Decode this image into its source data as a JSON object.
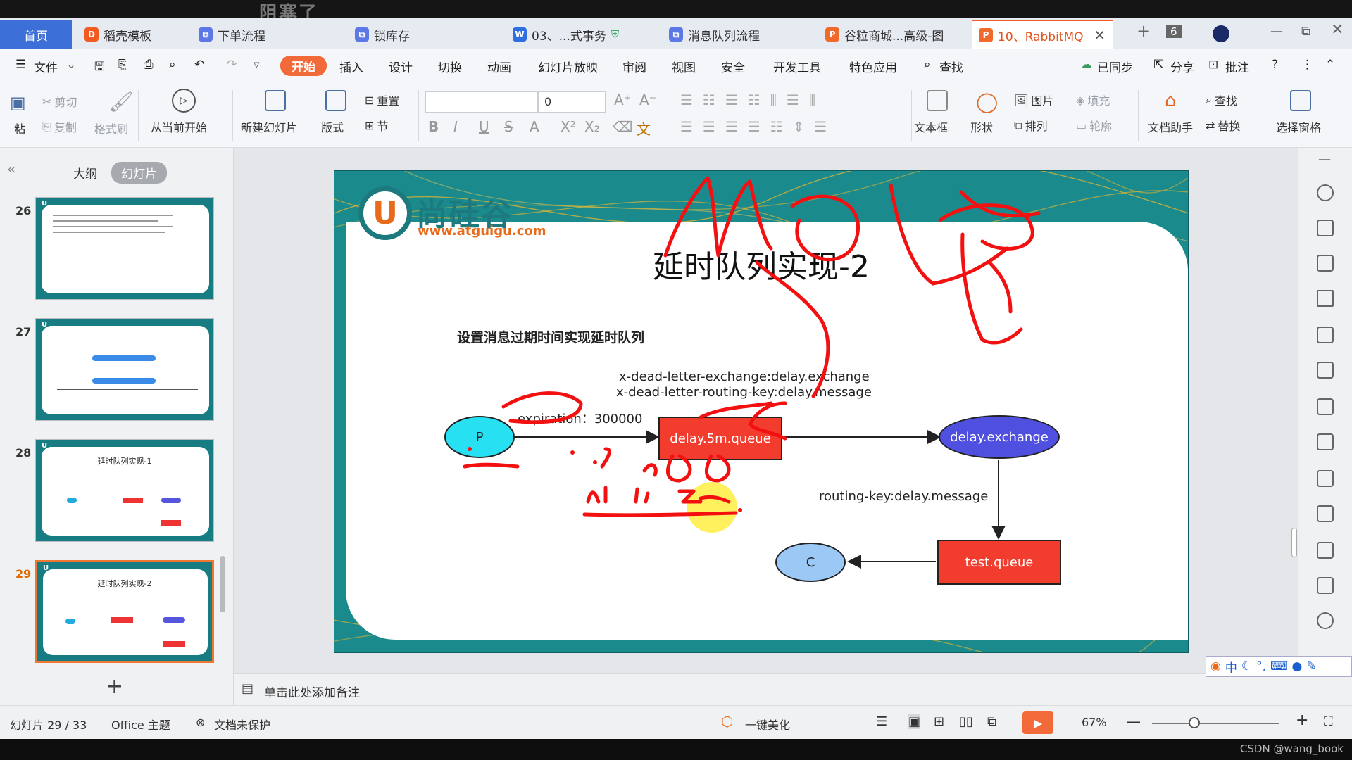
{
  "overlay_watermark": "阻塞了",
  "tabs": [
    {
      "label": "首页"
    },
    {
      "label": "稻壳模板"
    },
    {
      "label": "下单流程"
    },
    {
      "label": "锁库存"
    },
    {
      "label": "03、...式事务"
    },
    {
      "label": "消息队列流程"
    },
    {
      "label": "谷粒商城...高级-图"
    },
    {
      "label": "10、RabbitMQ"
    }
  ],
  "tab_count_badge": "6",
  "menu": {
    "file": "文件",
    "items": [
      "开始",
      "插入",
      "设计",
      "切换",
      "动画",
      "幻灯片放映",
      "审阅",
      "视图",
      "安全",
      "开发工具",
      "特色应用"
    ],
    "search": "查找",
    "sync": "已同步",
    "share": "分享",
    "annotate": "批注"
  },
  "ribbon": {
    "cut": "剪切",
    "copy": "复制",
    "format_painter": "格式刷",
    "paste_fragment": "粘",
    "from_current": "从当前开始",
    "new_slide": "新建幻灯片",
    "layout": "版式",
    "reset": "重置",
    "section": "节",
    "font_size_value": "0",
    "textbox": "文本框",
    "shape": "形状",
    "picture": "图片",
    "arrange": "排列",
    "fill": "填充",
    "outline": "轮廓",
    "find": "查找",
    "replace": "替换",
    "doc_assistant": "文档助手",
    "select_pane": "选择窗格"
  },
  "panel": {
    "outline_tab": "大纲",
    "slides_tab": "幻灯片",
    "thumbnails": [
      {
        "num": "26",
        "title": ""
      },
      {
        "num": "27",
        "title": ""
      },
      {
        "num": "28",
        "title": "延时队列实现-1"
      },
      {
        "num": "29",
        "title": "延时队列实现-2"
      }
    ],
    "add": "+"
  },
  "slide": {
    "logo_char": "U",
    "logo_text": "尚硅谷",
    "logo_url": "www.atguigu.com",
    "title": "延时队列实现-2",
    "subtitle": "设置消息过期时间实现延时队列",
    "header_line1": "x-dead-letter-exchange:delay.exchange",
    "header_line2": "x-dead-letter-routing-key:delay.message",
    "expiration_label": "expiration：300000",
    "routing_label": "routing-key:delay.message",
    "nodes": {
      "p": "P",
      "queue": "delay.5m.queue",
      "exchange": "delay.exchange",
      "test_queue": "test.queue",
      "c": "C"
    },
    "colors": {
      "producer": "#27e1f2",
      "queue": "#f23c2e",
      "exchange": "#5050e0",
      "consumer": "#9cc8f6",
      "ink": "#f21010"
    }
  },
  "notes_placeholder": "单击此处添加备注",
  "status": {
    "slide_info": "幻灯片 29 / 33",
    "theme": "Office 主题",
    "protect": "文档未保护",
    "beautify": "一键美化",
    "zoom": "67%"
  },
  "ime": "中",
  "csdn": "CSDN @wang_book"
}
